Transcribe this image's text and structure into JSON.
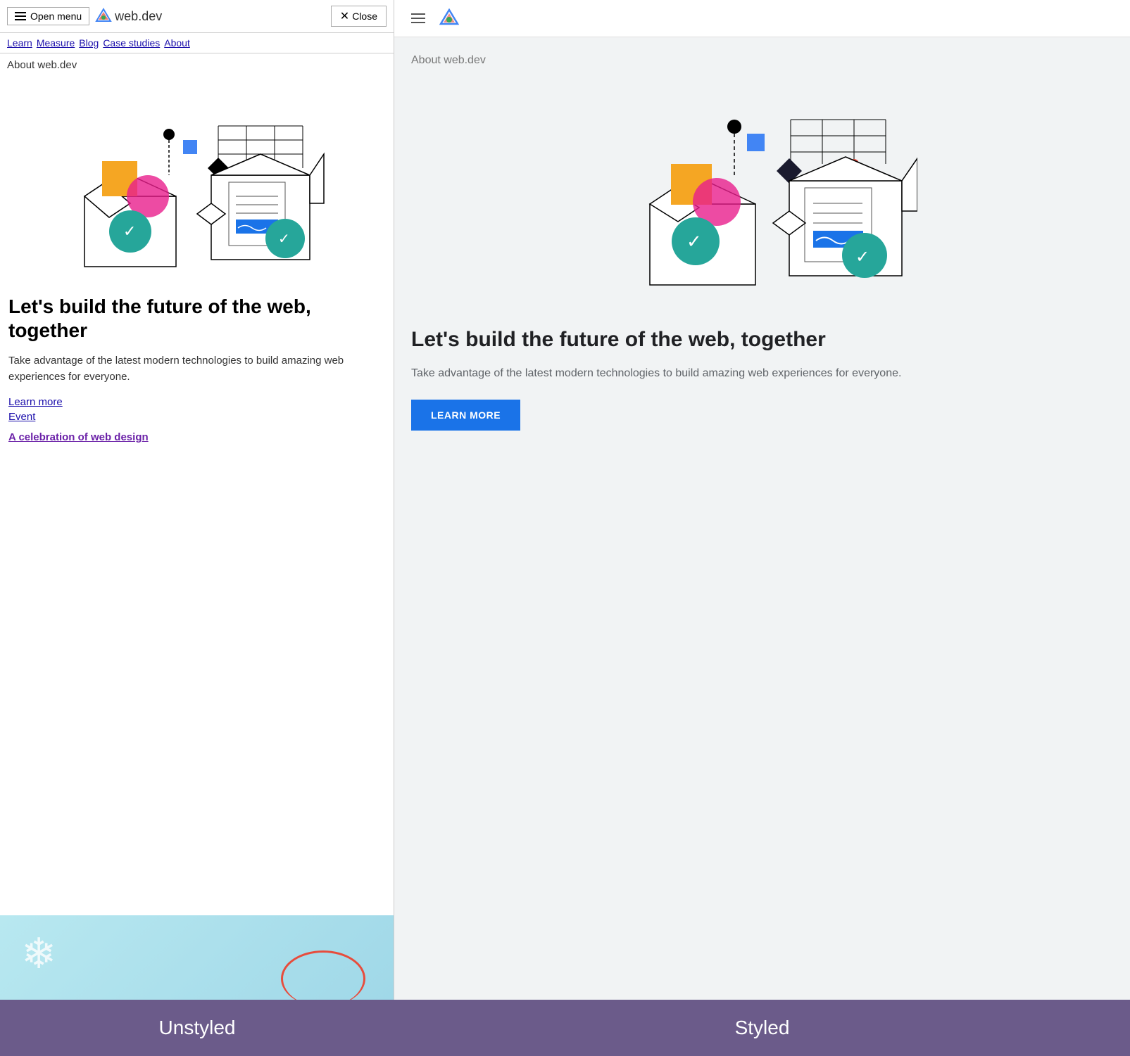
{
  "left": {
    "navbar": {
      "open_menu_label": "Open menu",
      "site_name": "web.dev",
      "close_label": "Close",
      "nav_links": [
        "Learn",
        "Measure",
        "Blog",
        "Case studies",
        "About"
      ]
    },
    "about_label": "About web.dev",
    "heading": "Let's build the future of the web, together",
    "description": "Take advantage of the latest modern technologies to build amazing web experiences for everyone.",
    "learn_more": "Learn more",
    "event": "Event",
    "celebration_link": "A celebration of web design"
  },
  "right": {
    "about_label": "About web.dev",
    "heading": "Let's build the future of the web, together",
    "description": "Take advantage of the latest modern technologies to build amazing web experiences for everyone.",
    "learn_more_btn": "LEARN MORE"
  },
  "labels": {
    "unstyled": "Unstyled",
    "styled": "Styled"
  },
  "colors": {
    "link": "#1a0dab",
    "purple_link": "#6b21a8",
    "blue_btn": "#1a73e8",
    "label_bg": "#6b5b8a"
  }
}
